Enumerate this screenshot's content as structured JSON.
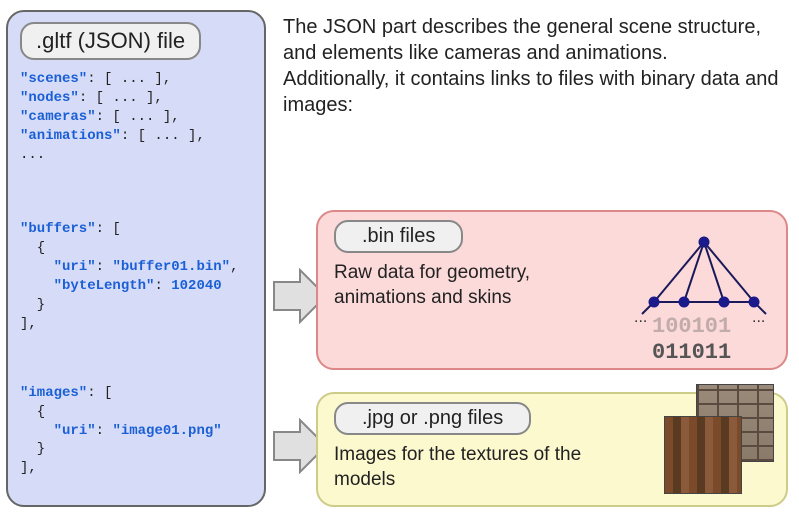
{
  "json_box": {
    "label": ".gltf (JSON) file",
    "code1_line1_key": "\"scenes\"",
    "code1_line1_rest": ": [ ... ],",
    "code1_line2_key": "\"nodes\"",
    "code1_line2_rest": ": [ ... ],",
    "code1_line3_key": "\"cameras\"",
    "code1_line3_rest": ": [ ... ],",
    "code1_line4_key": "\"animations\"",
    "code1_line4_rest": ": [ ... ],",
    "code1_line5": "...",
    "code2_line1_key": "\"buffers\"",
    "code2_line1_rest": ": [",
    "code2_line2": "  {",
    "code2_line3_pre": "    ",
    "code2_line3_key": "\"uri\"",
    "code2_line3_mid": ": ",
    "code2_line3_val": "\"buffer01.bin\"",
    "code2_line3_post": ",",
    "code2_line4_pre": "    ",
    "code2_line4_key": "\"byteLength\"",
    "code2_line4_mid": ": ",
    "code2_line4_val": "102040",
    "code2_line5": "  }",
    "code2_line6": "],",
    "code3_line1_key": "\"images\"",
    "code3_line1_rest": ": [",
    "code3_line2": "  {",
    "code3_line3_pre": "    ",
    "code3_line3_key": "\"uri\"",
    "code3_line3_mid": ": ",
    "code3_line3_val": "\"image01.png\"",
    "code3_line4": "  }",
    "code3_line5": "],"
  },
  "description": "The JSON part describes the general scene structure, and elements like cameras and animations.\nAdditionally, it contains links to files with binary data and images:",
  "bin_box": {
    "label": ".bin files",
    "description": "Raw data for geometry, animations and skins",
    "binary1": "100101",
    "binary2": "011011",
    "dots": "..."
  },
  "img_box": {
    "label": ".jpg or .png files",
    "description": "Images for the textures of the models"
  }
}
